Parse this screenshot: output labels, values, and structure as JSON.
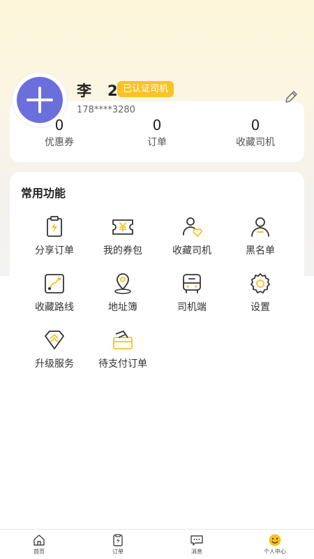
{
  "profile": {
    "name": "李　2",
    "badge": "已认证司机",
    "phone": "178****3280"
  },
  "stats": [
    {
      "value": "0",
      "label": "优惠券"
    },
    {
      "value": "0",
      "label": "订单"
    },
    {
      "value": "0",
      "label": "收藏司机"
    }
  ],
  "functions": {
    "title": "常用功能",
    "items": [
      {
        "label": "分享订单",
        "icon": "share-order-icon"
      },
      {
        "label": "我的券包",
        "icon": "coupon-icon"
      },
      {
        "label": "收藏司机",
        "icon": "favorite-driver-icon"
      },
      {
        "label": "黑名单",
        "icon": "blacklist-icon"
      },
      {
        "label": "收藏路线",
        "icon": "favorite-route-icon"
      },
      {
        "label": "地址簿",
        "icon": "address-book-icon"
      },
      {
        "label": "司机端",
        "icon": "driver-app-icon"
      },
      {
        "label": "设置",
        "icon": "settings-icon"
      },
      {
        "label": "升级服务",
        "icon": "upgrade-icon"
      },
      {
        "label": "待支付订单",
        "icon": "pending-payment-icon"
      }
    ]
  },
  "tabs": [
    {
      "label": "首页",
      "icon": "home-icon"
    },
    {
      "label": "订单",
      "icon": "orders-icon"
    },
    {
      "label": "消息",
      "icon": "message-icon"
    },
    {
      "label": "个人中心",
      "icon": "profile-icon",
      "active": true
    }
  ],
  "colors": {
    "accent": "#f7c325",
    "avatar": "#6b6fdc",
    "icon_stroke": "#333333"
  }
}
